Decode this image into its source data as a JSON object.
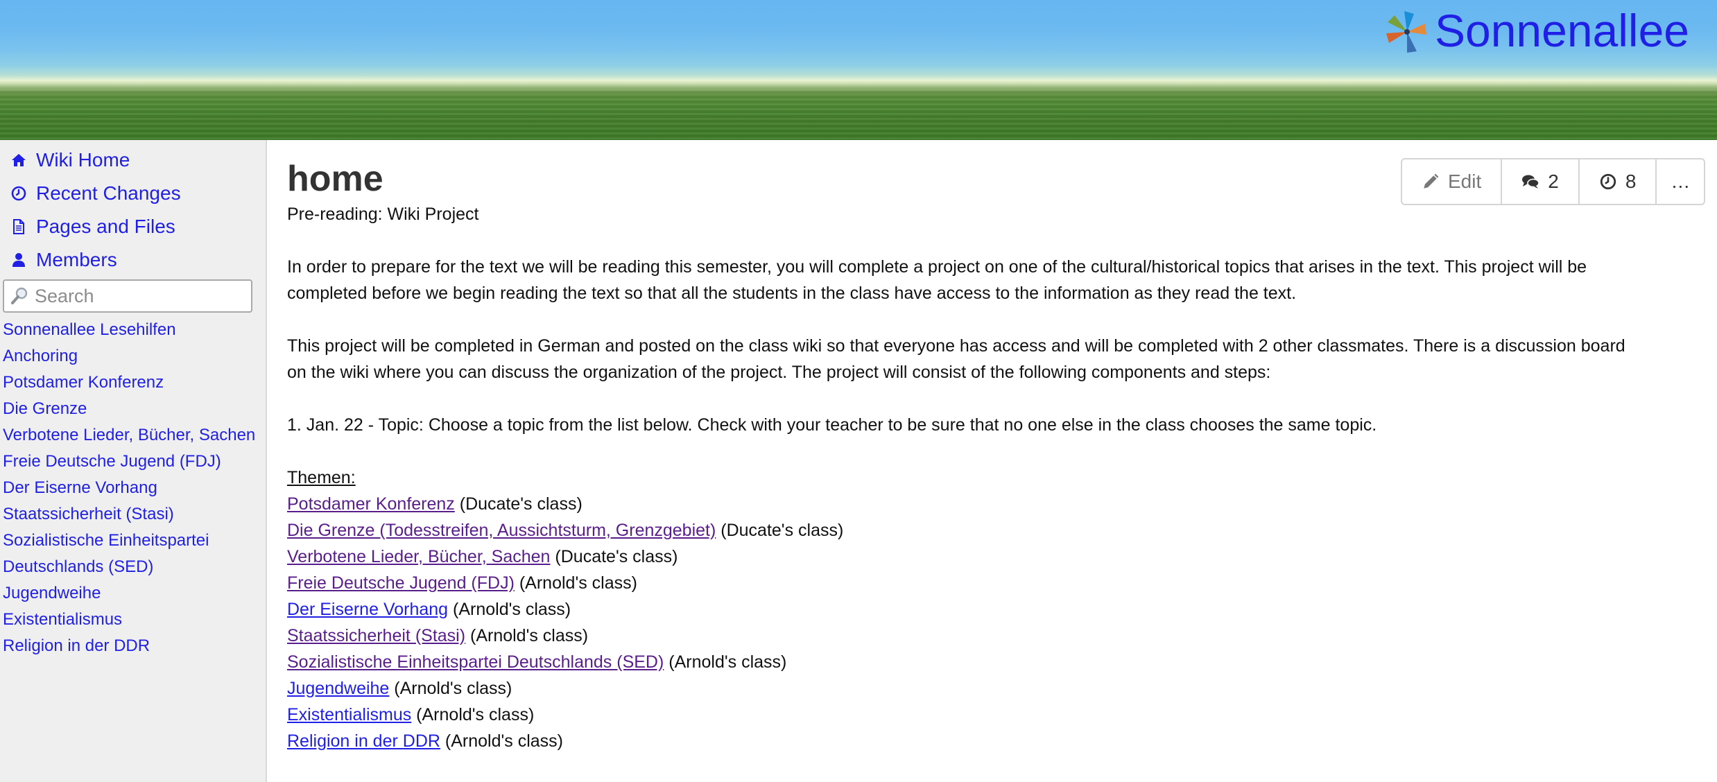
{
  "site": {
    "title": "Sonnenallee",
    "logo_icon": "pinwheel-logo-icon"
  },
  "colors": {
    "link": "#1f1fe6",
    "visited_link": "#5a1e8c",
    "sidebar_bg": "#efefef"
  },
  "nav": [
    {
      "label": "Wiki Home",
      "icon": "home-icon"
    },
    {
      "label": "Recent Changes",
      "icon": "clock-icon"
    },
    {
      "label": "Pages and Files",
      "icon": "document-icon"
    },
    {
      "label": "Members",
      "icon": "user-icon"
    }
  ],
  "search": {
    "placeholder": "Search"
  },
  "sidebar_links": [
    "Sonnenallee Lesehilfen",
    "Anchoring",
    "Potsdamer Konferenz",
    "Die Grenze",
    "Verbotene Lieder, Bücher, Sachen",
    "Freie Deutsche Jugend (FDJ)",
    "Der Eiserne Vorhang",
    "Staatssicherheit (Stasi)",
    "Sozialistische Einheitspartei Deutschlands (SED)",
    "Jugendweihe",
    "Existentialismus",
    "Religion in der DDR"
  ],
  "page": {
    "title": "home",
    "toolbar": {
      "edit_label": "Edit",
      "comments_count": "2",
      "revisions_count": "8",
      "more_label": "…"
    },
    "intro": "Pre-reading: Wiki Project",
    "para1": "In order to prepare for the text we will be reading this semester, you will complete a project on one of the cultural/historical topics that arises in the text. This project will be completed before we begin reading the text so that all the students in the class have access to the information as they read the text.",
    "para2": "This project will be completed in German and posted on the class wiki so that everyone has access and will be completed with 2 other classmates. There is a discussion board on the wiki where you can discuss the organization of the project. The project will consist of the following components and steps:",
    "step1": "1. Jan. 22 - Topic: Choose a topic from the list below. Check with your teacher to be sure that no one else in the class chooses the same topic.",
    "topics_heading": "Themen:",
    "topics": [
      {
        "link": "Potsdamer Konferenz",
        "note": " (Ducate's class)",
        "visited": true
      },
      {
        "link": "Die Grenze (Todesstreifen, Aussichtsturm, Grenzgebiet)",
        "note": " (Ducate's class)",
        "visited": true
      },
      {
        "link": "Verbotene Lieder, Bücher, Sachen",
        "note": " (Ducate's class)",
        "visited": true
      },
      {
        "link": "Freie Deutsche Jugend (FDJ)",
        "note": " (Arnold's class)",
        "visited": true
      },
      {
        "link": "Der Eiserne Vorhang",
        "note": " (Arnold's class)",
        "visited": false
      },
      {
        "link": "Staatssicherheit (Stasi)",
        "note": " (Arnold's class)",
        "visited": true
      },
      {
        "link": "Sozialistische Einheitspartei Deutschlands (SED)",
        "note": " (Arnold's class)",
        "visited": true
      },
      {
        "link": "Jugendweihe",
        "note": " (Arnold's class)",
        "visited": false
      },
      {
        "link": "Existentialismus",
        "note": " (Arnold's class)",
        "visited": false
      },
      {
        "link": "Religion in der DDR",
        "note": " (Arnold's class)",
        "visited": false
      }
    ]
  }
}
